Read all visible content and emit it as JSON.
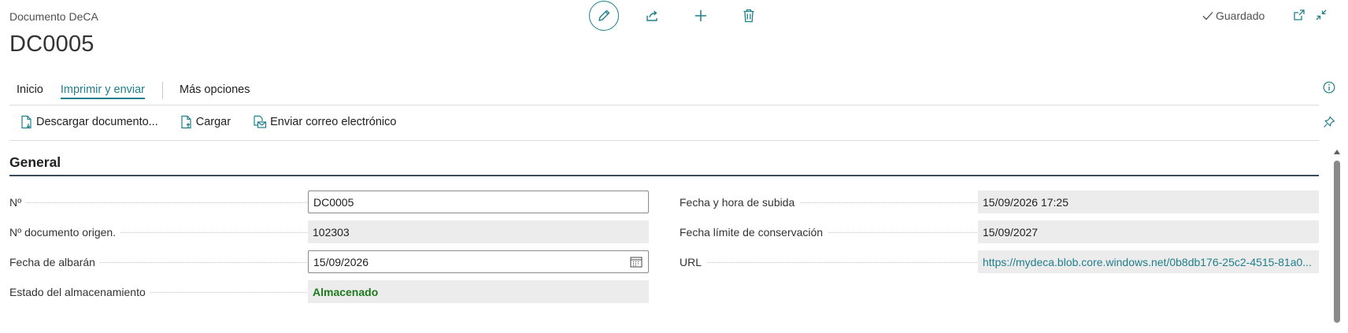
{
  "header": {
    "caption": "Documento DeCA",
    "title": "DC0005",
    "status": "Guardado"
  },
  "top_actions": [
    {
      "name": "edit-icon"
    },
    {
      "name": "share-icon"
    },
    {
      "name": "new-icon"
    },
    {
      "name": "delete-icon"
    }
  ],
  "tabs": [
    {
      "label": "Inicio",
      "active": false
    },
    {
      "label": "Imprimir y enviar",
      "active": true
    },
    {
      "label": "Más opciones",
      "active": false
    }
  ],
  "toolbar": {
    "download": "Descargar documento...",
    "upload": "Cargar",
    "email": "Enviar correo electrónico"
  },
  "section": {
    "title": "General"
  },
  "fields_left": [
    {
      "label": "Nº",
      "value": "DC0005",
      "kind": "input"
    },
    {
      "label": "Nº documento origen.",
      "value": "102303",
      "kind": "readonly"
    },
    {
      "label": "Fecha de albarán",
      "value": "15/09/2026",
      "kind": "date"
    },
    {
      "label": "Estado del almacenamiento",
      "value": "Almacenado",
      "kind": "status"
    }
  ],
  "fields_right": [
    {
      "label": "Fecha y hora de subida",
      "value": "15/09/2026 17:25",
      "kind": "readonly"
    },
    {
      "label": "Fecha límite de conservación",
      "value": "15/09/2027",
      "kind": "readonly"
    },
    {
      "label": "URL",
      "value": "https://mydeca.blob.core.windows.net/0b8db176-25c2-4515-81a0...",
      "kind": "link"
    }
  ],
  "colors": {
    "accent": "#1f7f8c",
    "status_ok": "#1d7a1d",
    "readonly_bg": "#ececec"
  }
}
